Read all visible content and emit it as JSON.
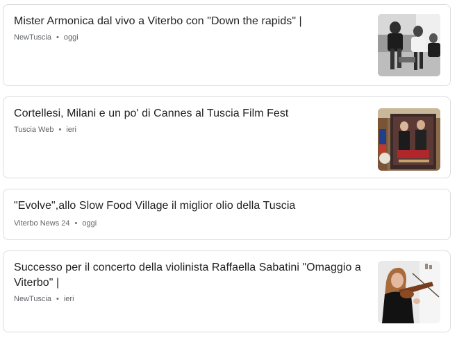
{
  "articles": [
    {
      "title": "Mister Armonica dal vivo a Viterbo con \"Down the rapids\" |",
      "source": "NewTuscia",
      "separator": "•",
      "time": "oggi",
      "thumbnail": "photo-band-bw"
    },
    {
      "title": "Cortellesi, Milani e un po' di Cannes al Tuscia Film Fest",
      "source": "Tuscia Web",
      "separator": "•",
      "time": "ieri",
      "thumbnail": "photo-film-fest-posters"
    },
    {
      "title": "\"Evolve\",allo Slow Food Village il miglior olio della Tuscia",
      "source": "Viterbo News 24",
      "separator": "•",
      "time": "oggi",
      "thumbnail": null
    },
    {
      "title": "Successo per il concerto della violinista Raffaella Sabatini \"Omaggio a Viterbo\" |",
      "source": "NewTuscia",
      "separator": "•",
      "time": "ieri",
      "thumbnail": "photo-violinist"
    }
  ]
}
